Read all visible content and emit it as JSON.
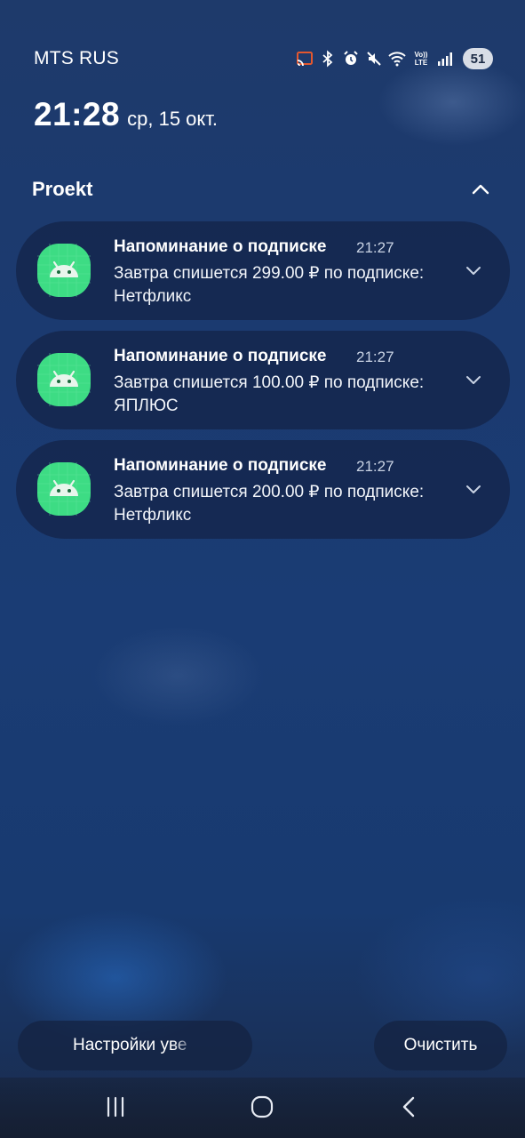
{
  "status_bar": {
    "carrier": "MTS RUS",
    "icons": [
      "cast-icon",
      "bluetooth-icon",
      "alarm-icon",
      "mute-icon",
      "wifi-icon",
      "volte-icon",
      "signal-icon"
    ],
    "volte_top": "Vo))",
    "volte_bottom": "LTE",
    "battery_level": "51"
  },
  "lockscreen": {
    "time": "21:28",
    "date": "ср, 15 окт."
  },
  "group": {
    "app_name": "Proekt"
  },
  "notifications": [
    {
      "title": "Напоминание о подписке",
      "time": "21:27",
      "body": "Завтра спишется 299.00 ₽ по подписке: Нетфликс"
    },
    {
      "title": "Напоминание о подписке",
      "time": "21:27",
      "body": "Завтра спишется 100.00 ₽ по подписке: ЯПЛЮС"
    },
    {
      "title": "Напоминание о подписке",
      "time": "21:27",
      "body": "Завтра спишется 200.00 ₽ по подписке: Нетфликс"
    }
  ],
  "actions": {
    "settings_label": "Настройки уве",
    "clear_label": "Очистить"
  },
  "colors": {
    "app_icon": "#3ddc84",
    "accent_bg": "#1b3a70"
  }
}
